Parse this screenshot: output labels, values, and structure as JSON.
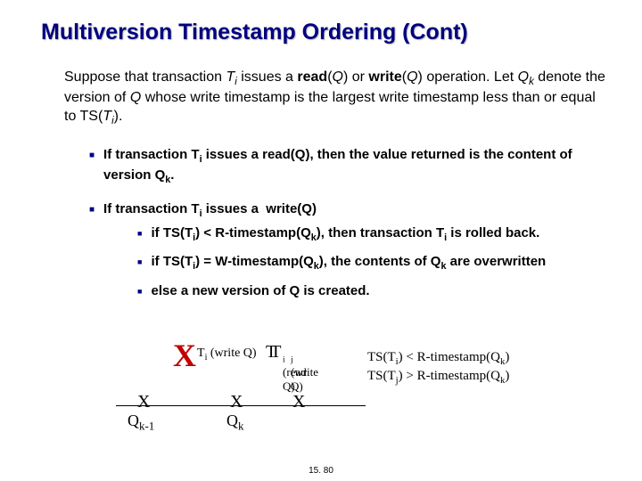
{
  "title": "Multiversion Timestamp Ordering (Cont)",
  "intro_html": "Suppose that transaction <span class='ital'>T<sub>i</sub></span> issues a <b>read</b>(<span class='ital'>Q</span>) or <b>write</b>(<span class='ital'>Q</span>) operation. Let <span class='ital'>Q<sub>k</sub></span> denote the version of <span class='ital'>Q</span> whose write timestamp is the largest write timestamp less than or equal to TS(<span class='ital'>T<sub>i</sub></span>).",
  "bullets": [
    "If transaction T<sub>i</sub> issues a <b>read</b>(Q), then the value returned is the content of version Q<sub>k</sub>.",
    "If transaction T<sub>i</sub> issues a&nbsp; <b>write</b>(Q)"
  ],
  "subbullets": [
    "if TS(T<sub>i</sub>) &lt; R-timestamp(Q<sub>k</sub>), then transaction T<sub>i</sub> is rolled back.",
    "if TS(T<sub>i</sub>) = W-timestamp(Q<sub>k</sub>), the contents of Q<sub>k</sub> are overwritten",
    "else a new version of Q is created."
  ],
  "diag": {
    "x": "X",
    "tiwrite": "T<sub>i</sub> (write Q)",
    "overlap1": "T<sub>i</sub> (read Q)",
    "overlap2": "T<sub>j</sub> (write Q)",
    "qk1": "Q<sub>k-1</sub>",
    "qk": "Q<sub>k</sub>",
    "rhs1": "TS(T<sub>i</sub>) &lt; R-timestamp(Q<sub>k</sub>)",
    "rhs2": "TS(T<sub>j</sub>) &gt; R-timestamp(Q<sub>k</sub>)"
  },
  "pagenum": "15. 80"
}
